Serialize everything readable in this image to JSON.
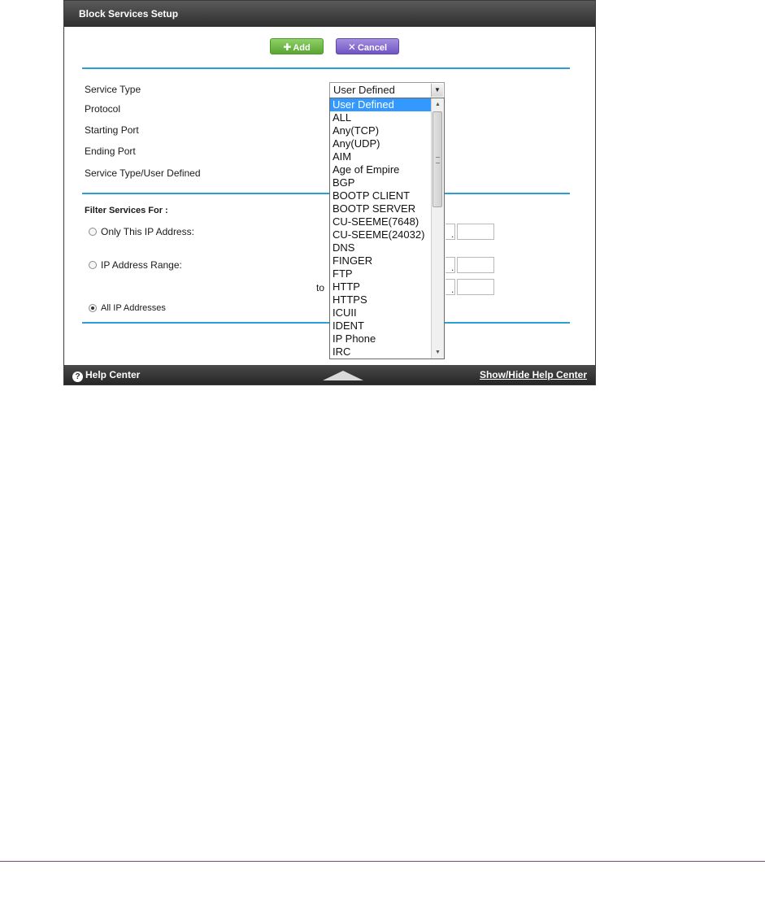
{
  "window": {
    "title": "Block Services Setup"
  },
  "toolbar": {
    "add_label": "Add",
    "cancel_label": "Cancel"
  },
  "form": {
    "service_type_label": "Service Type",
    "protocol_label": "Protocol",
    "starting_port_label": "Starting Port",
    "ending_port_label": "Ending Port",
    "service_type_user_defined_label": "Service Type/User Defined",
    "service_type_value": "User Defined"
  },
  "dropdown": {
    "options": [
      "User Defined",
      "ALL",
      "Any(TCP)",
      "Any(UDP)",
      "AIM",
      "Age of Empire",
      "BGP",
      "BOOTP CLIENT",
      "BOOTP SERVER",
      "CU-SEEME(7648)",
      "CU-SEEME(24032)",
      "DNS",
      "FINGER",
      "FTP",
      "HTTP",
      "HTTPS",
      "ICUII",
      "IDENT",
      "IP Phone",
      "IRC"
    ],
    "selected_index": 0
  },
  "filter": {
    "title": "Filter Services For :",
    "only_this_ip_label": "Only This IP Address:",
    "ip_range_label": "IP Address Range:",
    "to_label": "to",
    "all_ip_label": "All IP Addresses",
    "selected": "all"
  },
  "footer": {
    "help_label": "Help Center",
    "show_hide_label": "Show/Hide Help Center"
  },
  "colors": {
    "accent_line": "#2a9fd6",
    "add_green": "#6cb83f",
    "cancel_purple": "#7a60cc",
    "selection_blue": "#3399ff"
  }
}
